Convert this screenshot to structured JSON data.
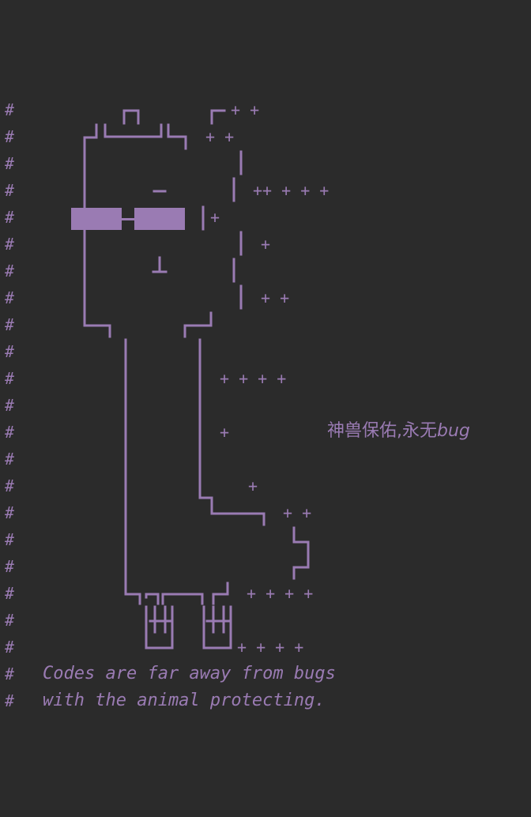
{
  "comment_marker": "#",
  "line_count": 21,
  "plus_marks": [
    {
      "text": "+ +"
    },
    {
      "text": "+ +"
    },
    {
      "text": "++ + + +"
    },
    {
      "text": "+"
    },
    {
      "text": "+"
    },
    {
      "text": "+ +"
    },
    {
      "text": "+ + + +"
    },
    {
      "text": "+"
    },
    {
      "text": "+"
    },
    {
      "text": "+ +"
    },
    {
      "text": "+ + + +"
    },
    {
      "text": "+ + + +"
    }
  ],
  "motto": {
    "prefix": "神兽保佑,永无",
    "suffix": "bug"
  },
  "comments": {
    "line1": "Codes are far away from bugs",
    "line2": "with the animal protecting."
  },
  "colors": {
    "background": "#2b2b2b",
    "comment": "#9a7bb3"
  }
}
